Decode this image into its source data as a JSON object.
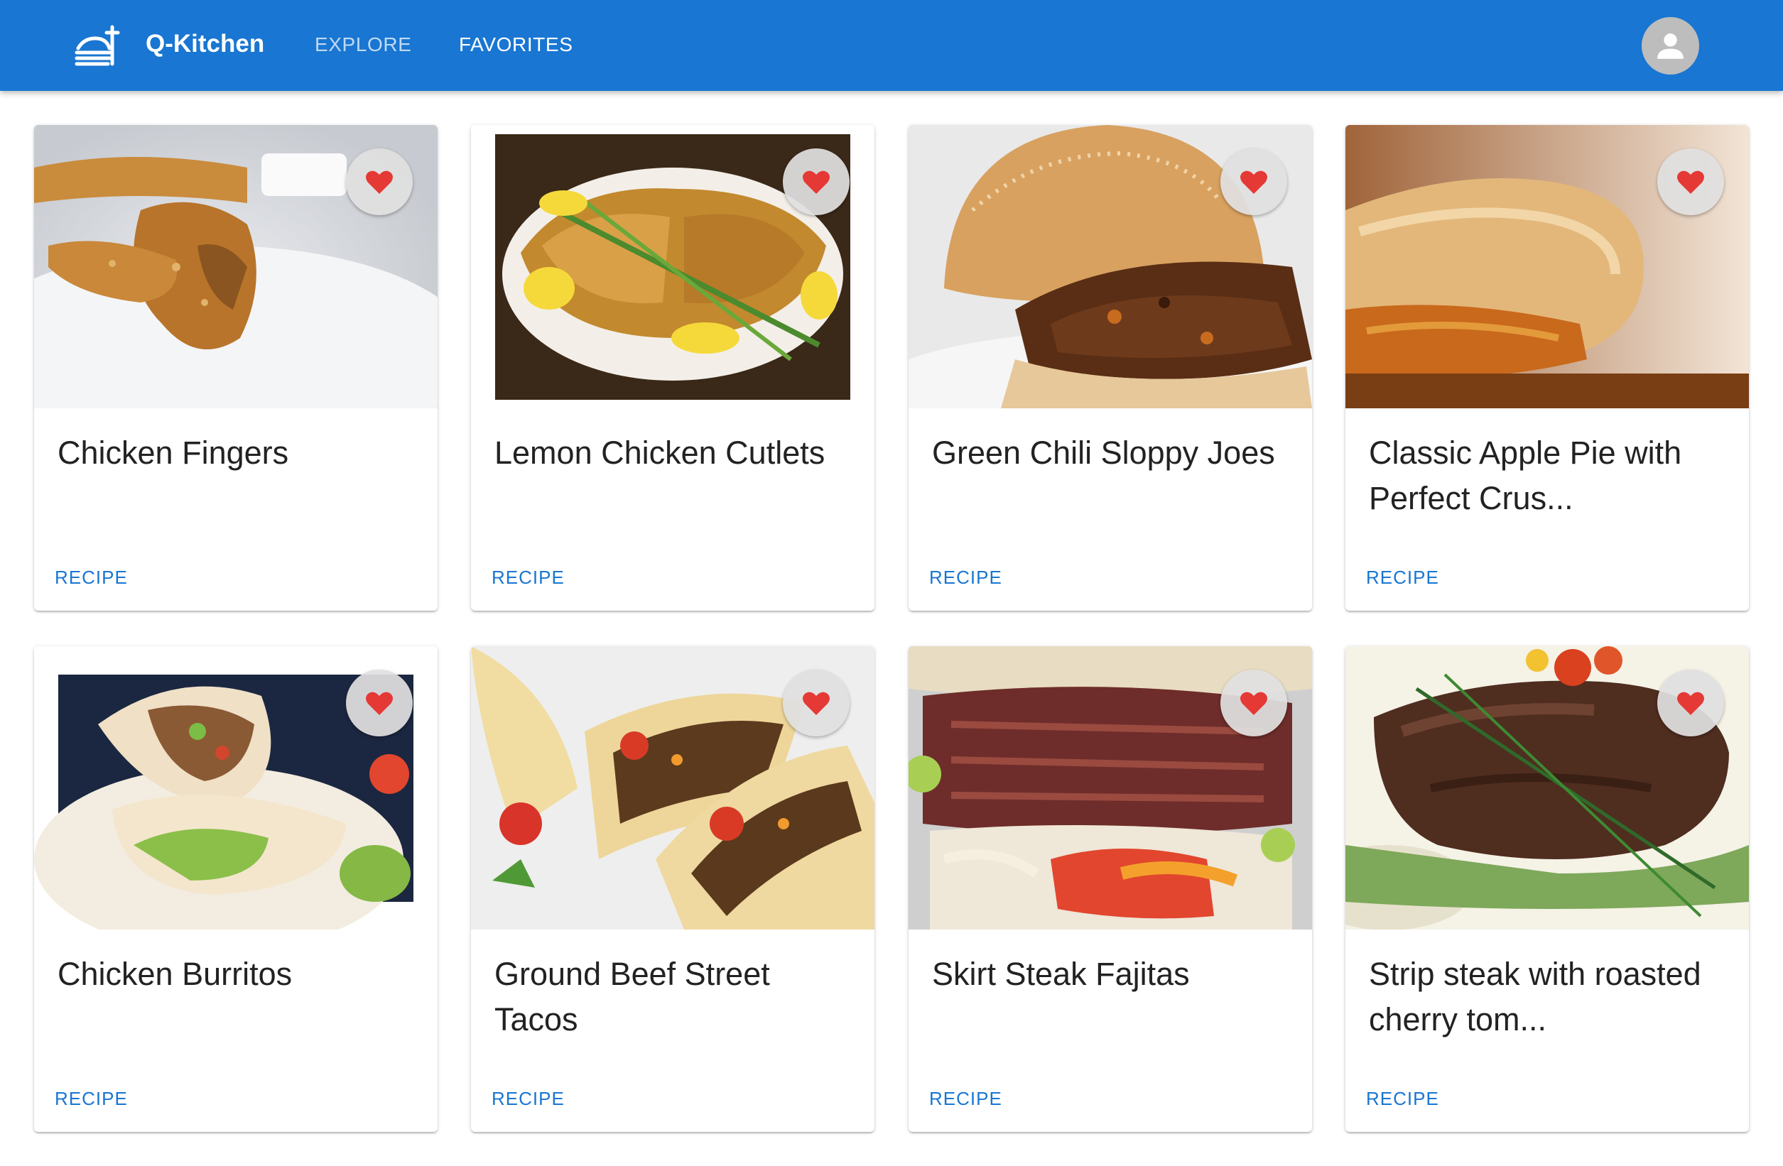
{
  "app": {
    "brand": "Q-Kitchen",
    "nav": [
      {
        "label": "EXPLORE"
      },
      {
        "label": "FAVORITES"
      }
    ],
    "colors": {
      "primary": "#1976d2",
      "favorite": "#e53935"
    }
  },
  "cards": [
    {
      "title": "Chicken Fingers",
      "action": "RECIPE"
    },
    {
      "title": "Lemon Chicken Cutlets",
      "action": "RECIPE"
    },
    {
      "title": "Green Chili Sloppy Joes",
      "action": "RECIPE"
    },
    {
      "title": "Classic Apple Pie with Perfect Crus...",
      "action": "RECIPE"
    },
    {
      "title": "Chicken Burritos",
      "action": "RECIPE"
    },
    {
      "title": "Ground Beef Street Tacos",
      "action": "RECIPE"
    },
    {
      "title": "Skirt Steak Fajitas",
      "action": "RECIPE"
    },
    {
      "title": "Strip steak with roasted cherry tom...",
      "action": "RECIPE"
    }
  ]
}
